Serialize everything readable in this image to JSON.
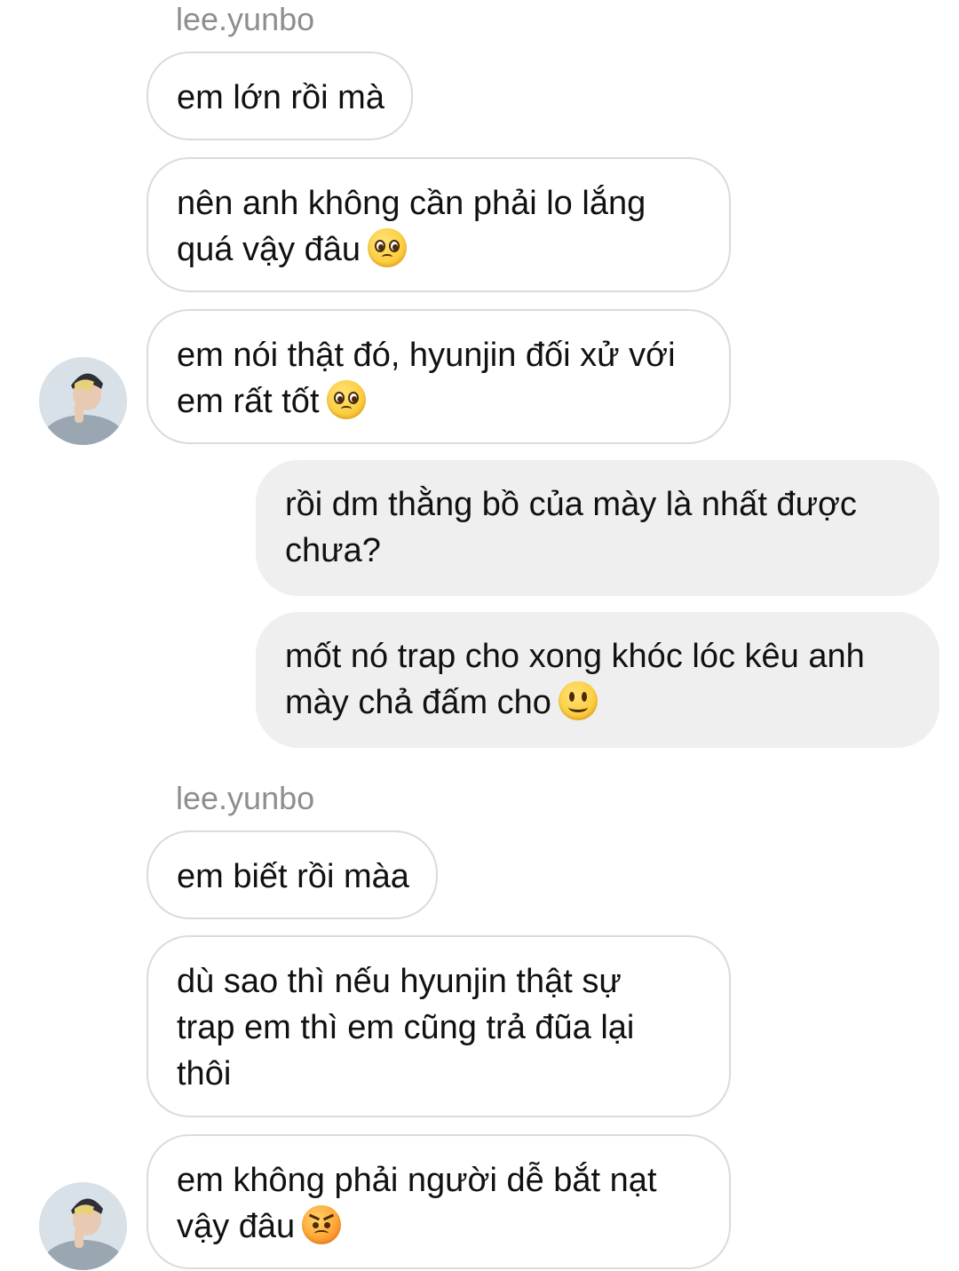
{
  "thread": {
    "sender_name_1": "lee.yunbo",
    "sender_name_2": "lee.yunbo",
    "messages": [
      {
        "lines": [
          "em lớn rồi mà"
        ]
      },
      {
        "lines": [
          "nên anh không cần phải lo lắng",
          "quá vậy đâu"
        ],
        "emoji": "pleading-face-emoji"
      },
      {
        "lines": [
          "em nói thật đó, hyunjin đối xử với",
          "em rất tốt"
        ],
        "emoji": "pleading-face-emoji"
      },
      {
        "lines": [
          "rồi dm thằng bồ của mày là nhất được",
          "chưa?"
        ]
      },
      {
        "lines": [
          "mốt nó trap cho xong khóc lóc kêu anh",
          "mày chả đấm cho"
        ],
        "emoji": "slightly-smiling-face-emoji"
      },
      {
        "lines": [
          "em biết rồi màa"
        ]
      },
      {
        "lines": [
          "dù sao thì nếu hyunjin thật sự",
          "trap em thì em cũng trả đũa lại",
          "thôi"
        ]
      },
      {
        "lines": [
          "em không phải người dễ bắt nạt",
          "vậy đâu"
        ],
        "emoji": "angry-face-emoji"
      }
    ]
  },
  "colors": {
    "incoming_border": "#dbdbdb",
    "outgoing_bg": "#efefef",
    "sender_name": "#8e8e8e"
  }
}
